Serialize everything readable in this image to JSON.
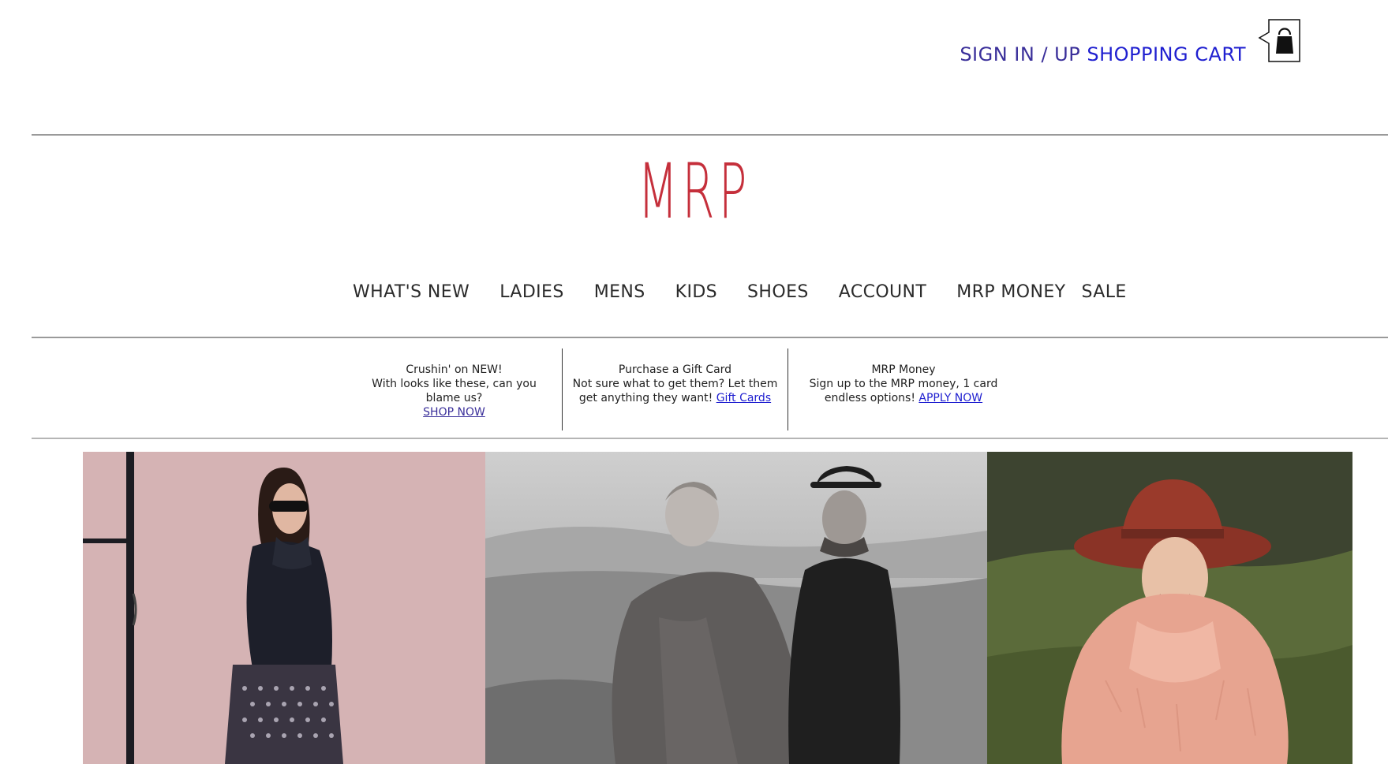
{
  "header": {
    "sign_in_label": "SIGN IN / UP",
    "cart_label": "SHOPPING CART",
    "cart_icon": "shopping-bag-icon"
  },
  "brand": {
    "logo_text": "MRP",
    "logo_color": "#c52f3b"
  },
  "nav": {
    "items": [
      "WHAT'S NEW",
      "LADIES",
      "MENS",
      "KIDS",
      "SHOES",
      "ACCOUNT",
      "MRP MONEY",
      "SALE"
    ]
  },
  "promos": [
    {
      "title": "Crushin' on NEW!",
      "body": "With looks like these, can you blame us?",
      "link": "SHOP NOW"
    },
    {
      "title": "Purchase a Gift Card",
      "body": "Not sure what to get them? Let them get anything they want!",
      "link": "Gift Cards"
    },
    {
      "title": "MRP Money",
      "body": "Sign up to the MRP money, 1 card endless options!",
      "link": "APPLY NOW"
    }
  ],
  "colors": {
    "link_blue": "#1f1fd0",
    "visited_purple": "#3a2f9a",
    "divider": "#9a9a9a"
  }
}
